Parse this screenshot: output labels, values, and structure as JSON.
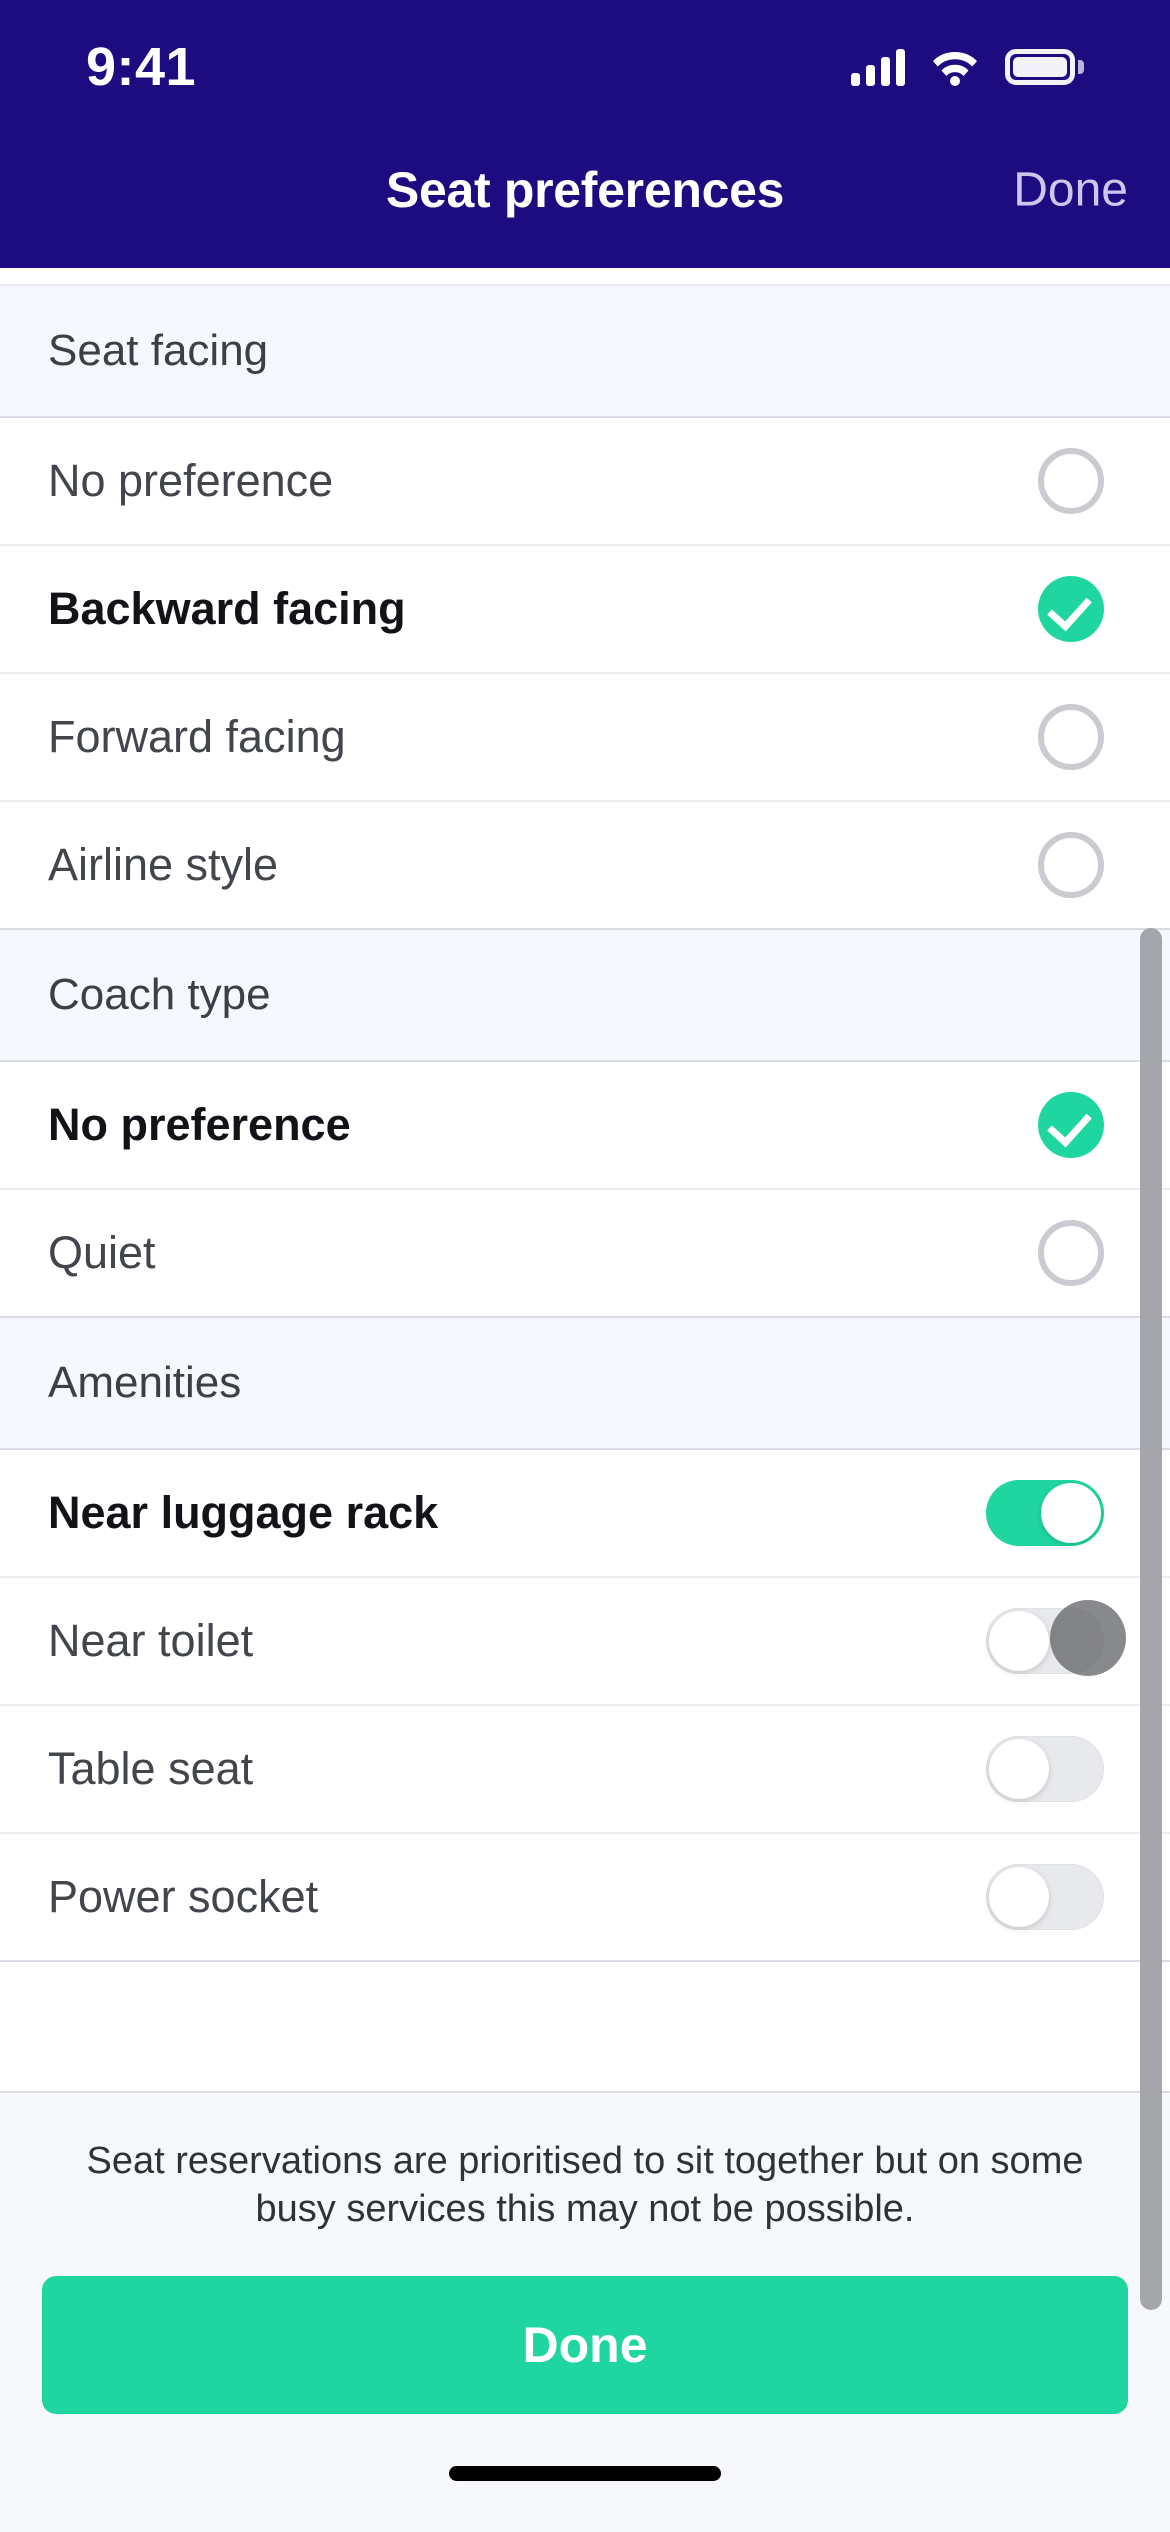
{
  "status_bar": {
    "time": "9:41",
    "signal_icon": "cellular-signal-icon",
    "wifi_icon": "wifi-icon",
    "battery_icon": "battery-icon"
  },
  "navbar": {
    "title": "Seat preferences",
    "done_label": "Done"
  },
  "colors": {
    "header_navy": "#1d0b80",
    "accent_green": "#1fd6a0",
    "section_bg": "#f6f8fd",
    "row_bg": "#ffffff",
    "navbar_done_text": "#cfc6ee",
    "scrollbar": "#a4a6ab",
    "cursor": "#5a5c60"
  },
  "sections": [
    {
      "title": "Seat facing",
      "control": "radio",
      "rows": [
        {
          "label": "No preference",
          "selected": false
        },
        {
          "label": "Backward facing",
          "selected": true
        },
        {
          "label": "Forward facing",
          "selected": false
        },
        {
          "label": "Airline style",
          "selected": false
        }
      ]
    },
    {
      "title": "Coach type",
      "control": "radio",
      "rows": [
        {
          "label": "No preference",
          "selected": true
        },
        {
          "label": "Quiet",
          "selected": false
        }
      ]
    },
    {
      "title": "Amenities",
      "control": "toggle",
      "rows": [
        {
          "label": "Near luggage rack",
          "selected": true
        },
        {
          "label": "Near toilet",
          "selected": false
        },
        {
          "label": "Table seat",
          "selected": false
        },
        {
          "label": "Power socket",
          "selected": false
        }
      ]
    }
  ],
  "footer": {
    "note": "Seat reservations are prioritised to sit together but on some busy services this may not be possible.",
    "done_label": "Done"
  }
}
